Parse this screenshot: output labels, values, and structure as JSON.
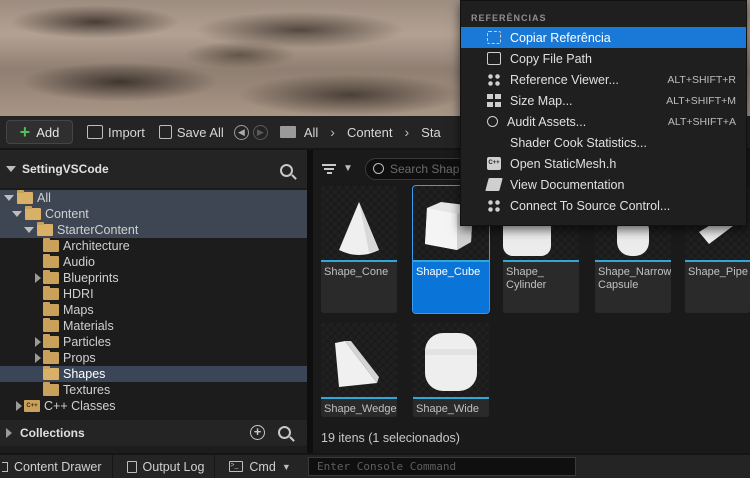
{
  "toolbar": {
    "add_label": "Add",
    "import_label": "Import",
    "save_all_label": "Save All",
    "breadcrumbs": [
      "All",
      "Content",
      "Sta"
    ]
  },
  "sources": {
    "title": "SettingVSCode",
    "tree": [
      {
        "label": "All",
        "level": 0,
        "expanded": true
      },
      {
        "label": "Content",
        "level": 1,
        "expanded": true
      },
      {
        "label": "StarterContent",
        "level": 2,
        "expanded": true
      },
      {
        "label": "Architecture",
        "level": 3
      },
      {
        "label": "Audio",
        "level": 3
      },
      {
        "label": "Blueprints",
        "level": 3,
        "has_children": true
      },
      {
        "label": "HDRI",
        "level": 3
      },
      {
        "label": "Maps",
        "level": 3
      },
      {
        "label": "Materials",
        "level": 3
      },
      {
        "label": "Particles",
        "level": 3,
        "has_children": true
      },
      {
        "label": "Props",
        "level": 3,
        "has_children": true
      },
      {
        "label": "Shapes",
        "level": 3,
        "selected": true
      },
      {
        "label": "Textures",
        "level": 3
      },
      {
        "label": "C++ Classes",
        "level": 1,
        "has_children": true
      }
    ],
    "collections_label": "Collections"
  },
  "assets": {
    "search_placeholder": "Search Shap",
    "tiles": [
      {
        "label": "Shape_Cone",
        "shape": "cone"
      },
      {
        "label": "Shape_Cube",
        "shape": "cube",
        "selected": true
      },
      {
        "label": "Shape_ Cylinder",
        "shape": "cylinder"
      },
      {
        "label": "Shape_Narrow Capsule",
        "shape": "capsule"
      },
      {
        "label": "Shape_Pipe",
        "shape": "pipe"
      },
      {
        "label": "Shape_Wedge",
        "shape": "wedge"
      },
      {
        "label": "Shape_Wide",
        "shape": "wide"
      }
    ],
    "status": "19 itens (1 selecionados)"
  },
  "context_menu": {
    "section": "REFERÊNCIAS",
    "items": [
      {
        "label": "Copiar Referência",
        "shortcut": "",
        "icon": "copy-reference-icon",
        "active": true
      },
      {
        "label": "Copy File Path",
        "shortcut": "",
        "icon": "copy-path-icon"
      },
      {
        "label": "Reference Viewer...",
        "shortcut": "ALT+SHIFT+R",
        "icon": "reference-viewer-icon"
      },
      {
        "label": "Size Map...",
        "shortcut": "ALT+SHIFT+M",
        "icon": "size-map-icon"
      },
      {
        "label": "Audit Assets...",
        "shortcut": "ALT+SHIFT+A",
        "icon": "audit-icon"
      },
      {
        "label": "Shader Cook Statistics...",
        "shortcut": "",
        "icon": "shader-stats-icon"
      },
      {
        "label": "Open StaticMesh.h",
        "shortcut": "",
        "icon": "code-icon"
      },
      {
        "label": "View Documentation",
        "shortcut": "",
        "icon": "documentation-icon"
      },
      {
        "label": "Connect To Source Control...",
        "shortcut": "",
        "icon": "source-control-icon"
      }
    ]
  },
  "bottom_bar": {
    "content_drawer": "Content Drawer",
    "output_log": "Output Log",
    "cmd": "Cmd",
    "console_placeholder": "Enter Console Command"
  },
  "colors": {
    "accent": "#1a78d6",
    "selection_tile": "#0a74d8",
    "folder": "#c9a15a",
    "tile_underline": "#2fa8d8"
  }
}
